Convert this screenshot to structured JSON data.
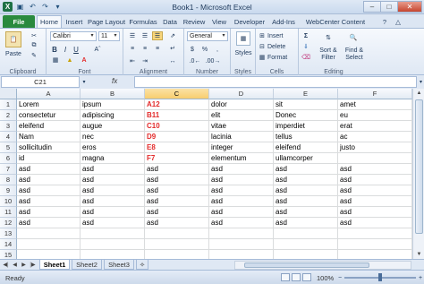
{
  "app": {
    "title": "Book1 - Microsoft Excel",
    "window_controls": [
      "–",
      "□",
      "✕"
    ]
  },
  "quick_access": [
    "save-icon",
    "undo-icon",
    "redo-icon"
  ],
  "tabs": [
    {
      "label": "File"
    },
    {
      "label": "Home"
    },
    {
      "label": "Insert"
    },
    {
      "label": "Page Layout"
    },
    {
      "label": "Formulas"
    },
    {
      "label": "Data"
    },
    {
      "label": "Review"
    },
    {
      "label": "View"
    },
    {
      "label": "Developer"
    },
    {
      "label": "Add-Ins"
    },
    {
      "label": "WebCenter Content"
    }
  ],
  "ribbon": {
    "clipboard": {
      "label": "Clipboard",
      "paste": "Paste"
    },
    "font": {
      "label": "Font",
      "name": "Calibri",
      "size": "11"
    },
    "alignment": {
      "label": "Alignment"
    },
    "number": {
      "label": "Number",
      "format": "General",
      "currency": "$",
      "percent": "%"
    },
    "styles": {
      "label": "Styles",
      "button": "Styles"
    },
    "cells": {
      "label": "Cells",
      "insert": "Insert",
      "delete": "Delete",
      "format": "Format"
    },
    "editing": {
      "label": "Editing",
      "sort": "Sort &",
      "sort2": "Filter",
      "find": "Find &",
      "find2": "Select"
    }
  },
  "formula_bar": {
    "name_box": "C21",
    "fx": "fx",
    "value": ""
  },
  "columns": [
    "A",
    "B",
    "C",
    "D",
    "E",
    "F"
  ],
  "rows": [
    [
      "Lorem",
      "ipsum",
      "A12",
      "dolor",
      "sit",
      "amet"
    ],
    [
      "consectetur",
      "adipiscing",
      "B11",
      "elit",
      "Donec",
      "eu"
    ],
    [
      "eleifend",
      "augue",
      "C10",
      "vitae",
      "imperdiet",
      "erat"
    ],
    [
      "Nam",
      "nec",
      "D9",
      "lacinia",
      "tellus",
      "ac"
    ],
    [
      "sollicitudin",
      "eros",
      "E8",
      "integer",
      "eleifend",
      "justo"
    ],
    [
      "id",
      "magna",
      "F7",
      "elementum",
      "ullamcorper",
      ""
    ],
    [
      "asd",
      "asd",
      "asd",
      "asd",
      "asd",
      "asd"
    ],
    [
      "asd",
      "asd",
      "asd",
      "asd",
      "asd",
      "asd"
    ],
    [
      "asd",
      "asd",
      "asd",
      "asd",
      "asd",
      "asd"
    ],
    [
      "asd",
      "asd",
      "asd",
      "asd",
      "asd",
      "asd"
    ],
    [
      "asd",
      "asd",
      "asd",
      "asd",
      "asd",
      "asd"
    ],
    [
      "asd",
      "asd",
      "asd",
      "asd",
      "asd",
      "asd"
    ],
    [
      "",
      "",
      "",
      "",
      "",
      ""
    ],
    [
      "",
      "",
      "",
      "",
      "",
      ""
    ],
    [
      "",
      "",
      "",
      "",
      "",
      ""
    ]
  ],
  "row_numbers": [
    "1",
    "2",
    "3",
    "4",
    "5",
    "6",
    "7",
    "8",
    "9",
    "10",
    "11",
    "12",
    "13",
    "14",
    "15"
  ],
  "sheets": [
    "Sheet1",
    "Sheet2",
    "Sheet3"
  ],
  "status": {
    "text": "Ready",
    "zoom": "100%"
  },
  "colors": {
    "accent_red": "#e32b2b",
    "file_tab": "#2a8a3e",
    "selected_header": "#f8cd6f"
  }
}
